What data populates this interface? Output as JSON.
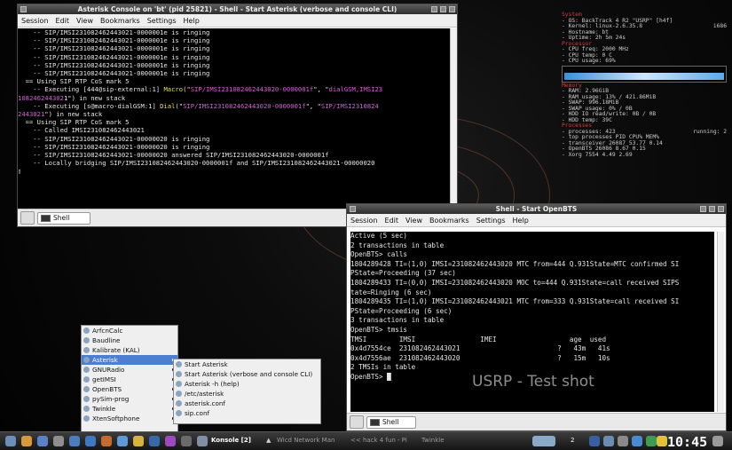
{
  "desktop": {
    "watermark": "USRP - Test shot"
  },
  "win1": {
    "title": "Asterisk Console on 'bt' (pid 25821) - Shell - Start Asterisk (verbose and console CLI)",
    "menu": [
      "Session",
      "Edit",
      "View",
      "Bookmarks",
      "Settings",
      "Help"
    ],
    "lines": [
      [
        [
          "    -- SIP/IMSI231082462443021-0000001e is ringing",
          ""
        ]
      ],
      [
        [
          "    -- SIP/IMSI231082462443021-0000001e is ringing",
          ""
        ]
      ],
      [
        [
          "    -- SIP/IMSI231082462443021-0000001e is ringing",
          ""
        ]
      ],
      [
        [
          "    -- SIP/IMSI231082462443021-0000001e is ringing",
          ""
        ]
      ],
      [
        [
          "    -- SIP/IMSI231082462443021-0000001e is ringing",
          ""
        ]
      ],
      [
        [
          "    -- SIP/IMSI231082462443021-0000001e is ringing",
          ""
        ]
      ],
      [
        [
          "  == Using SIP RTP CoS mark 5",
          ""
        ]
      ],
      [
        [
          "    -- Executing [444@sip-external:1] ",
          ""
        ],
        [
          "Macro",
          "y"
        ],
        [
          "(\"",
          ""
        ],
        [
          "SIP/IMSI231082462443020-0000001f",
          "m"
        ],
        [
          "\", \"",
          ""
        ],
        [
          "dialGSM,IMSI23",
          "m"
        ]
      ],
      [
        [
          "108246244302",
          "m"
        ],
        [
          "1\") in new stack",
          ""
        ]
      ],
      [
        [
          "    -- Executing [s@macro-dialGSM:1] ",
          ""
        ],
        [
          "Dial",
          "y"
        ],
        [
          "(\"",
          ""
        ],
        [
          "SIP/IMSI231082462443020-0000001f",
          "m"
        ],
        [
          "\", \"",
          ""
        ],
        [
          "SIP/IMSI2310824",
          "m"
        ]
      ],
      [
        [
          "2443021",
          "m"
        ],
        [
          "\") in new stack",
          ""
        ]
      ],
      [
        [
          "  == Using SIP RTP CoS mark 5",
          ""
        ]
      ],
      [
        [
          "    -- Called IMSI231082462443021",
          ""
        ]
      ],
      [
        [
          "    -- SIP/IMSI231082462443021-00000020 is ringing",
          ""
        ]
      ],
      [
        [
          "    -- SIP/IMSI231082462443021-00000020 is ringing",
          ""
        ]
      ],
      [
        [
          "    -- SIP/IMSI231082462443021-00000020 answered SIP/IMSI231082462443020-0000001f",
          ""
        ]
      ],
      [
        [
          "    -- Locally bridging SIP/IMSI231082462443020-0000001f and SIP/IMSI231082462443021-00000020",
          ""
        ]
      ]
    ],
    "tab": "Shell"
  },
  "win2": {
    "title": "Shell - Start OpenBTS",
    "menu": [
      "Session",
      "Edit",
      "View",
      "Bookmarks",
      "Settings",
      "Help"
    ],
    "lines": [
      "Active (5 sec)",
      "",
      "2 transactions in table",
      "OpenBTS> calls",
      "1804289428 TI=(1,0) IMSI=231082462443020 MTC from=444 Q.931State=MTC confirmed SI",
      "PState=Proceeding (37 sec)",
      "1804289433 TI=(0,0) IMSI=231082462443020 MOC to=444 Q.931State=call received SIPS",
      "tate=Ringing (6 sec)",
      "1804289435 TI=(1,0) IMSI=231082462443021 MTC from=333 Q.931State=call received SI",
      "PState=Proceeding (6 sec)",
      "",
      "3 transactions in table",
      "OpenBTS> tmsis",
      "TMSI        IMSI                IMEI                  age  used",
      "0x4d7554ce  231082462443021                        ?   43m   41s",
      "0x4d7556ae  231082462443020                        ?   15m   10s",
      "",
      "2 TMSIs in table",
      "OpenBTS> "
    ],
    "tab": "Shell"
  },
  "conky": {
    "system": "System",
    "rows1": [
      [
        "OS:  BackTrack 4 R2  \"USRP\"  [h4f]",
        ""
      ],
      [
        "Kernel:  linux-2.6.35.8",
        "i686"
      ],
      [
        "Hostname:  bt",
        ""
      ],
      [
        "Uptime:  2h 5m 24s",
        ""
      ]
    ],
    "processor": "Processor",
    "rows2": [
      [
        "CPU freq:  2000 MHz",
        ""
      ],
      [
        "CPU temp:  0 C",
        ""
      ],
      [
        "CPU usage:  69%",
        ""
      ]
    ],
    "memory": "Memory",
    "rows3": [
      [
        "RAM:  2.96GiB",
        ""
      ],
      [
        "RAM usage:  13% / 421.86MiB",
        ""
      ],
      [
        "SWAP:  996.18MiB",
        ""
      ],
      [
        "SWAP usage:  0% / 0B",
        ""
      ],
      [
        "HDD IO read/write:  0B / 0B",
        ""
      ],
      [
        "HDD temp:  39C",
        ""
      ]
    ],
    "processes": "Processes",
    "rows4": [
      [
        "processes: 423",
        "running: 2"
      ],
      [
        "top processes        PID    CPU%      MEM%",
        ""
      ],
      [
        "  transceiver          26087   53.77    0.14",
        ""
      ],
      [
        "  OpenBTS              26086    8.67    0.15",
        ""
      ],
      [
        "  Xorg                  7554    4.49    2.69",
        ""
      ]
    ]
  },
  "menu1": [
    "ArfcnCalc",
    "Baudline",
    "Kalibrate (KAL)",
    "Asterisk",
    "GNURadio",
    "getIMSI",
    "OpenBTS",
    "pySim-prog",
    "Twinkle",
    "XtenSoftphone"
  ],
  "menu2": [
    "Start Asterisk",
    "Start Asterisk (verbose and console CLI)",
    "Asterisk -h (help)",
    "/etc/asterisk",
    "asterisk.conf",
    "sip.conf"
  ],
  "taskbar": {
    "konsole": "Konsole [2]",
    "wicd": "Wicd Network Man",
    "hack": "<< hack 4 fun - Pi",
    "twinkle": "Twinkle",
    "desk": "2",
    "clock": "10:45"
  }
}
